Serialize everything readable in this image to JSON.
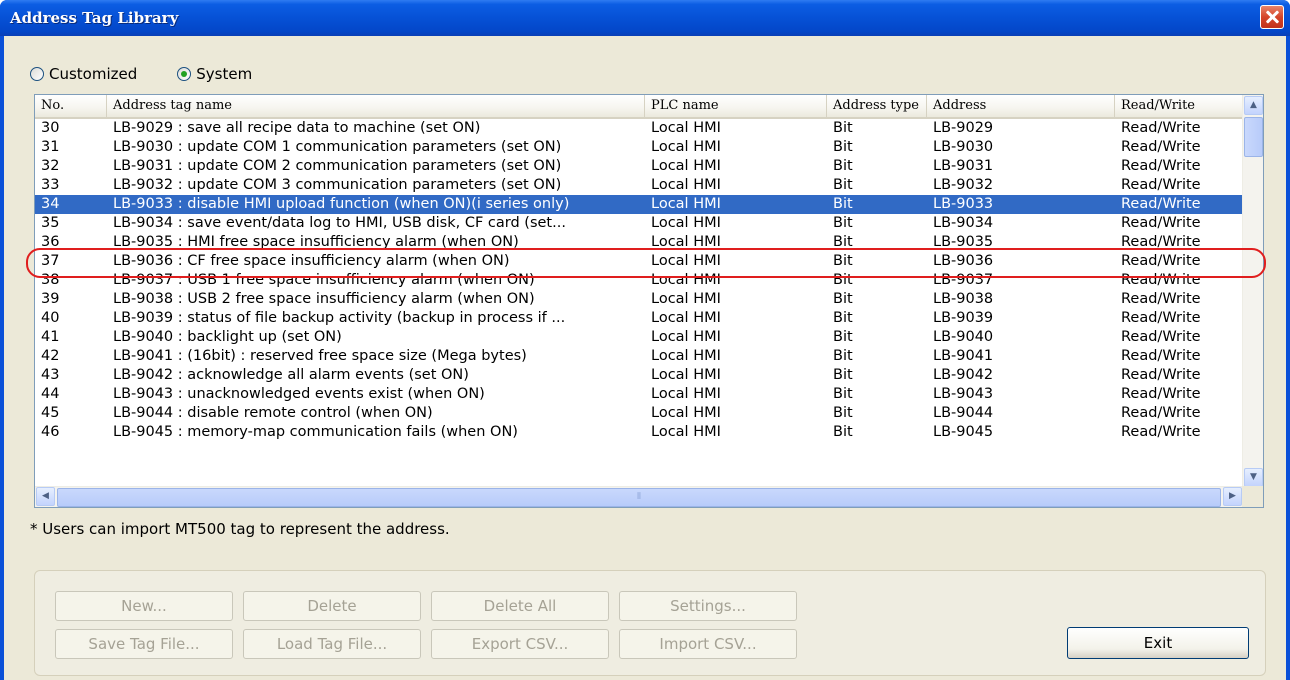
{
  "window": {
    "title": "Address Tag Library"
  },
  "radios": [
    {
      "label": "Customized",
      "checked": false
    },
    {
      "label": "System",
      "checked": true
    }
  ],
  "table": {
    "columns": [
      "No.",
      "Address tag name",
      "PLC name",
      "Address type",
      "Address",
      "Read/Write"
    ],
    "selected_no": "34",
    "rows": [
      [
        "30",
        "LB-9029 : save all recipe data to machine (set ON)",
        "Local HMI",
        "Bit",
        "LB-9029",
        "Read/Write"
      ],
      [
        "31",
        "LB-9030 : update COM 1 communication parameters (set ON)",
        "Local HMI",
        "Bit",
        "LB-9030",
        "Read/Write"
      ],
      [
        "32",
        "LB-9031 : update COM 2 communication parameters (set ON)",
        "Local HMI",
        "Bit",
        "LB-9031",
        "Read/Write"
      ],
      [
        "33",
        "LB-9032 : update COM 3 communication parameters (set ON)",
        "Local HMI",
        "Bit",
        "LB-9032",
        "Read/Write"
      ],
      [
        "34",
        "LB-9033 : disable HMI upload function (when ON)(i series only)",
        "Local HMI",
        "Bit",
        "LB-9033",
        "Read/Write"
      ],
      [
        "35",
        "LB-9034 : save event/data log to HMI, USB disk, CF card (set...",
        "Local HMI",
        "Bit",
        "LB-9034",
        "Read/Write"
      ],
      [
        "36",
        "LB-9035 : HMI free space insufficiency alarm (when ON)",
        "Local HMI",
        "Bit",
        "LB-9035",
        "Read/Write"
      ],
      [
        "37",
        "LB-9036 : CF free space insufficiency alarm (when ON)",
        "Local HMI",
        "Bit",
        "LB-9036",
        "Read/Write"
      ],
      [
        "38",
        "LB-9037 : USB 1 free space insufficiency alarm (when ON)",
        "Local HMI",
        "Bit",
        "LB-9037",
        "Read/Write"
      ],
      [
        "39",
        "LB-9038 : USB 2 free space insufficiency alarm (when ON)",
        "Local HMI",
        "Bit",
        "LB-9038",
        "Read/Write"
      ],
      [
        "40",
        "LB-9039 : status of file backup activity (backup in process if ...",
        "Local HMI",
        "Bit",
        "LB-9039",
        "Read/Write"
      ],
      [
        "41",
        "LB-9040 : backlight up (set ON)",
        "Local HMI",
        "Bit",
        "LB-9040",
        "Read/Write"
      ],
      [
        "42",
        "LB-9041 : (16bit) : reserved free space size (Mega bytes)",
        "Local HMI",
        "Bit",
        "LB-9041",
        "Read/Write"
      ],
      [
        "43",
        "LB-9042 : acknowledge all alarm events (set ON)",
        "Local HMI",
        "Bit",
        "LB-9042",
        "Read/Write"
      ],
      [
        "44",
        "LB-9043 : unacknowledged events exist (when ON)",
        "Local HMI",
        "Bit",
        "LB-9043",
        "Read/Write"
      ],
      [
        "45",
        "LB-9044 : disable remote control (when ON)",
        "Local HMI",
        "Bit",
        "LB-9044",
        "Read/Write"
      ],
      [
        "46",
        "LB-9045 : memory-map communication fails (when ON)",
        "Local HMI",
        "Bit",
        "LB-9045",
        "Read/Write"
      ]
    ]
  },
  "note": "* Users can import MT500 tag to represent the address.",
  "buttons": {
    "new": "New...",
    "delete": "Delete",
    "delete_all": "Delete All",
    "settings": "Settings...",
    "save_tag_file": "Save Tag File...",
    "load_tag_file": "Load Tag File...",
    "export_csv": "Export CSV...",
    "import_csv": "Import CSV...",
    "exit": "Exit"
  },
  "icons": {
    "close": "close-icon",
    "scroll_up": "arrow-up-icon",
    "scroll_down": "arrow-down-icon",
    "scroll_left": "arrow-left-icon",
    "scroll_right": "arrow-right-icon"
  },
  "colors": {
    "title_bar": "#0651d6",
    "selection": "#316ac5",
    "highlight_ring": "#e01e1e",
    "dialog_face": "#ece9d8"
  }
}
